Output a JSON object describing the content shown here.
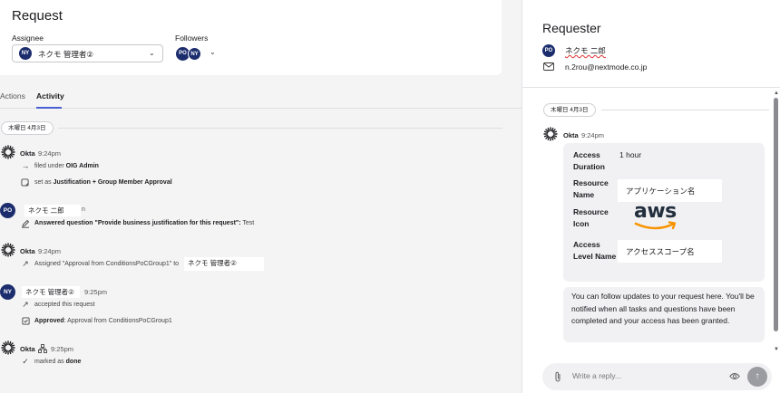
{
  "request": {
    "title": "Request",
    "assignee_label": "Assignee",
    "assignee_initials": "NY",
    "assignee_name": "ネクモ 管理者②",
    "followers_label": "Followers",
    "follower_initials": [
      "PO",
      "NY"
    ]
  },
  "tabs": [
    {
      "label": "Actions",
      "active": false
    },
    {
      "label": "Activity",
      "active": true
    }
  ],
  "activity": {
    "date": "木曜日 4月3日",
    "okta_name": "Okta",
    "events": {
      "e1_time": "9:24pm",
      "e1_line1_prefix": "filed under",
      "e1_line1_bold": "OIG Admin",
      "e1_line2_prefix": "set as",
      "e1_line2_bold": "Justification + Group Member Approval",
      "e2_initials": "PO",
      "e2_name": "ネクモ 二郎",
      "e2_trail": "n",
      "e2_bold": "Answered question \"Provide business justification for this request\":",
      "e2_rest": "Test",
      "e3_time": "9:24pm",
      "e3_line": "Assigned \"Approval from ConditionsPoCGroup1\" to",
      "e3_assignee": "ネクモ 管理者②",
      "e4_initials": "NY",
      "e4_name": "ネクモ 管理者②",
      "e4_time": "9:25pm",
      "e4_line1": "accepted this request",
      "e4_line2_bold": "Approved",
      "e4_line2_rest": ": Approval from ConditionsPoCGroup1",
      "e5_time": "9:25pm",
      "e5_line_prefix": "marked as",
      "e5_line_bold": "done"
    }
  },
  "requester": {
    "title": "Requester",
    "initials": "PO",
    "name": "ネクモ 二郎",
    "email": "n.2rou@nextmode.co.jp"
  },
  "chat": {
    "date": "木曜日 4月3日",
    "sender": "Okta",
    "time": "9:24pm",
    "fields": {
      "access_duration_label": "Access Duration",
      "access_duration_value": "1 hour",
      "resource_name_label": "Resource Name",
      "resource_name_value": "アプリケーション名",
      "resource_icon_label": "Resource Icon",
      "resource_icon_text": "aws",
      "access_level_label": "Access Level Name",
      "access_level_value": "アクセススコープ名"
    },
    "message": "You can follow updates to your request here. You'll be notified when all tasks and questions have been completed and your access has been granted.",
    "reply_placeholder": "Write a reply..."
  },
  "colors": {
    "avatar": "#1c2d6e",
    "tab_accent": "#4b5fd4",
    "aws_orange": "#f79400"
  }
}
